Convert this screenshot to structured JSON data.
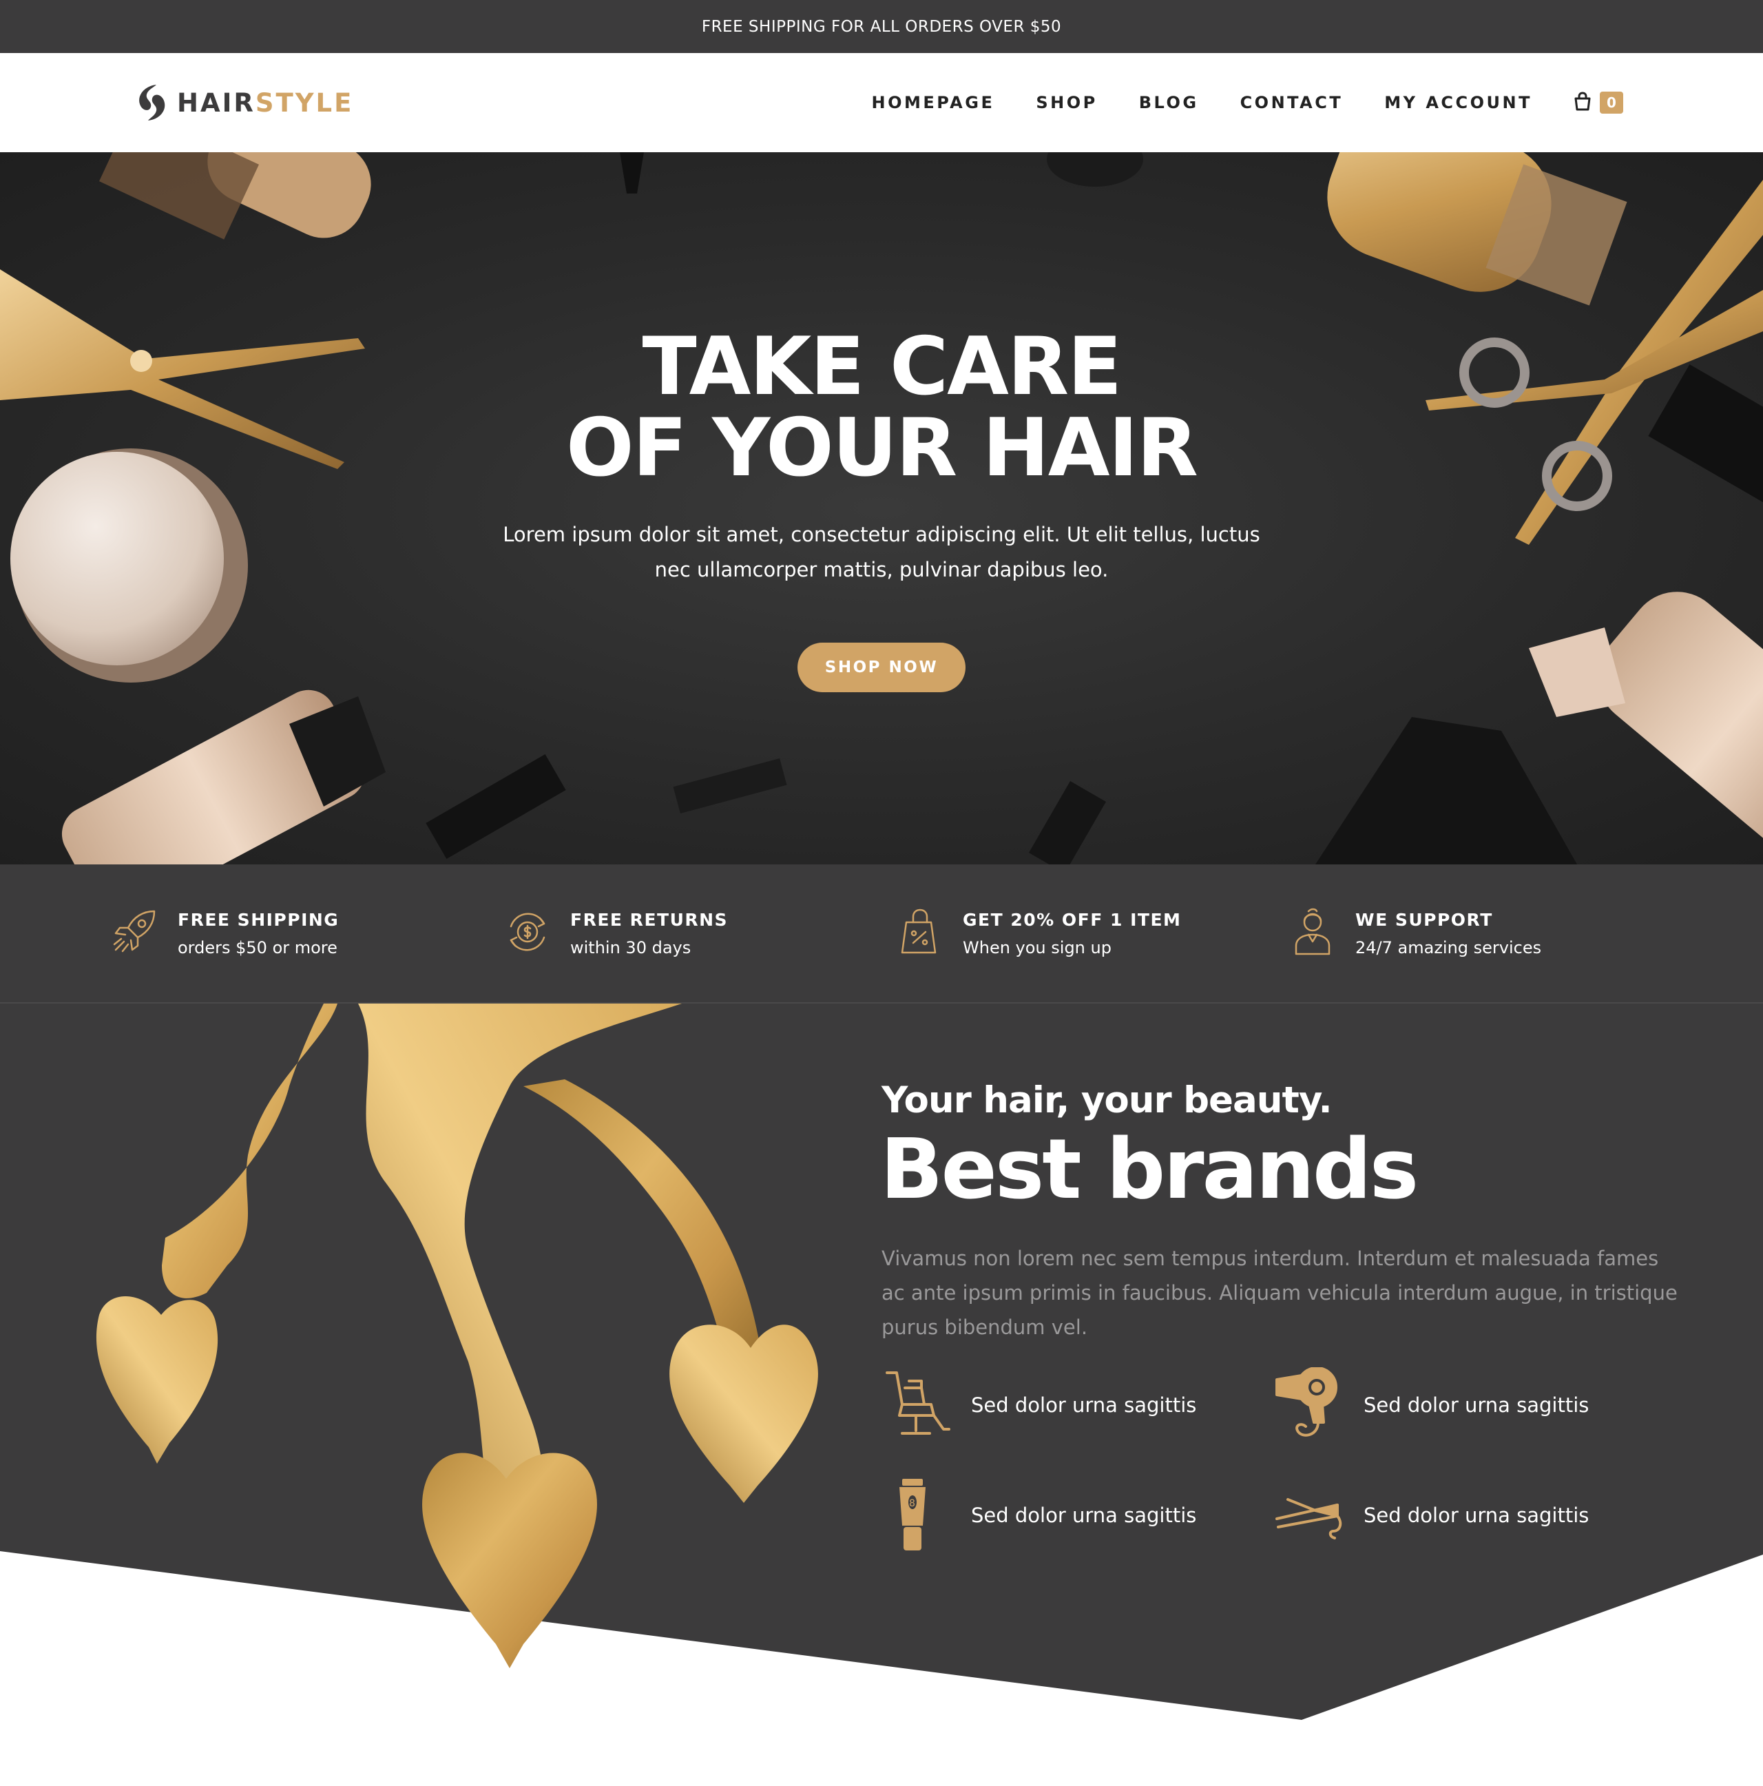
{
  "topbar": {
    "text": "FREE SHIPPING FOR ALL ORDERS OVER $50"
  },
  "header": {
    "logo": {
      "part1": "HAIR",
      "part2": "STYLE"
    },
    "nav": [
      "HOMEPAGE",
      "SHOP",
      "BLOG",
      "CONTACT",
      "MY ACCOUNT"
    ],
    "cart_count": "0"
  },
  "hero": {
    "title_line1": "TAKE CARE",
    "title_line2": "OF YOUR HAIR",
    "subtitle": "Lorem ipsum dolor sit amet, consectetur adipiscing elit. Ut elit tellus, luctus nec ullamcorper mattis, pulvinar dapibus leo.",
    "button": "SHOP NOW"
  },
  "features": [
    {
      "title": "FREE SHIPPING",
      "text": "orders $50 or more",
      "icon": "rocket-icon"
    },
    {
      "title": "FREE RETURNS",
      "text": "within 30 days",
      "icon": "money-return-icon"
    },
    {
      "title": "GET 20% OFF 1 ITEM",
      "text": "When you sign up",
      "icon": "discount-bag-icon"
    },
    {
      "title": "WE SUPPORT",
      "text": "24/7 amazing services",
      "icon": "support-person-icon"
    }
  ],
  "brands": {
    "tagline": "Your hair, your beauty.",
    "heading": "Best brands",
    "description": "Vivamus non lorem nec sem tempus interdum. Interdum et malesuada fames ac ante ipsum primis in faucibus. Aliquam vehicula interdum augue, in tristique purus bibendum vel.",
    "items": [
      {
        "label": "Sed dolor urna sagittis",
        "icon": "barber-chair-icon"
      },
      {
        "label": "Sed dolor urna sagittis",
        "icon": "hair-dryer-icon"
      },
      {
        "label": "Sed dolor urna sagittis",
        "icon": "hair-clipper-icon"
      },
      {
        "label": "Sed dolor urna sagittis",
        "icon": "hair-straightener-icon"
      }
    ]
  },
  "colors": {
    "dark": "#3c3b3c",
    "gold": "#d1a466",
    "white": "#ffffff",
    "muted": "#9a999a"
  }
}
